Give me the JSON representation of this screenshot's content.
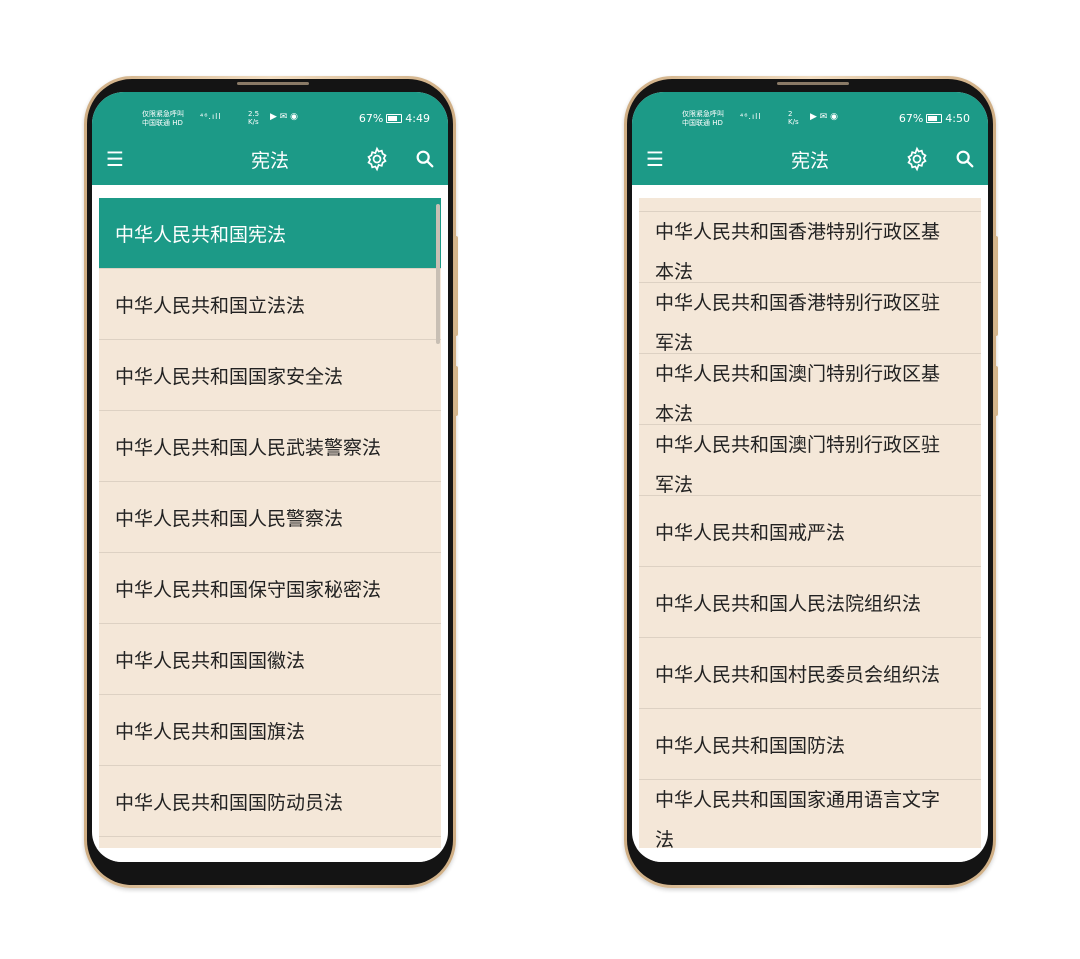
{
  "screens": [
    {
      "status": {
        "carrier_line1": "仅限紧急呼叫",
        "carrier_line2": "中国联通 HD",
        "signal": "⁴⁶.ıll",
        "net_speed_value": "2.5",
        "net_speed_unit": "K/s",
        "battery": "67%",
        "time": "4:49"
      },
      "toolbar": {
        "title": "宪法"
      },
      "items": [
        {
          "label": "中华人民共和国宪法",
          "active": true
        },
        {
          "label": "中华人民共和国立法法"
        },
        {
          "label": "中华人民共和国国家安全法"
        },
        {
          "label": "中华人民共和国人民武装警察法"
        },
        {
          "label": "中华人民共和国人民警察法"
        },
        {
          "label": "中华人民共和国保守国家秘密法"
        },
        {
          "label": "中华人民共和国国徽法"
        },
        {
          "label": "中华人民共和国国旗法"
        },
        {
          "label": "中华人民共和国国防动员法"
        }
      ]
    },
    {
      "status": {
        "carrier_line1": "仅限紧急呼叫",
        "carrier_line2": "中国联通 HD",
        "signal": "⁴⁶.ıll",
        "net_speed_value": "2",
        "net_speed_unit": "K/s",
        "battery": "67%",
        "time": "4:50"
      },
      "toolbar": {
        "title": "宪法"
      },
      "items": [
        {
          "line1": "中华人民共和国香港特别行政区基",
          "line2": "本法"
        },
        {
          "line1": "中华人民共和国香港特别行政区驻",
          "line2": "军法"
        },
        {
          "line1": "中华人民共和国澳门特别行政区基",
          "line2": "本法"
        },
        {
          "line1": "中华人民共和国澳门特别行政区驻",
          "line2": "军法"
        },
        {
          "label": "中华人民共和国戒严法"
        },
        {
          "label": "中华人民共和国人民法院组织法"
        },
        {
          "label": "中华人民共和国村民委员会组织法"
        },
        {
          "label": "中华人民共和国国防法"
        },
        {
          "line1": "中华人民共和国国家通用语言文字",
          "line2": "法"
        }
      ]
    }
  ],
  "colors": {
    "accent": "#1c9a87",
    "list_bg": "#f4e7d8",
    "frame_gold": "#d8b98f"
  }
}
